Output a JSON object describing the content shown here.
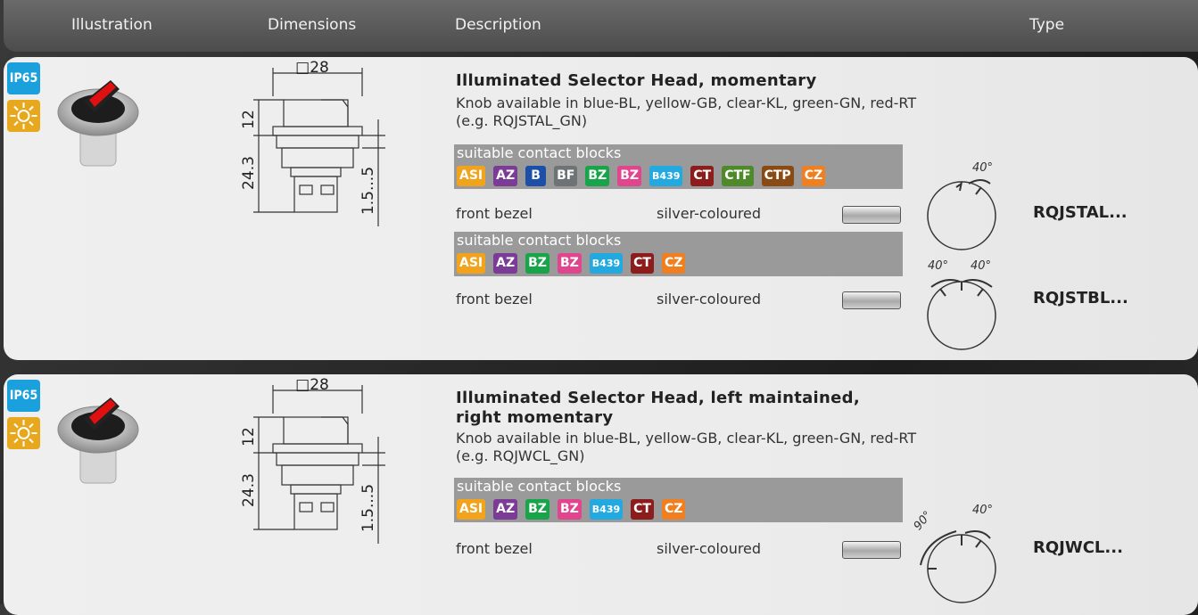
{
  "header": {
    "illustration": "Illustration",
    "dimensions": "Dimensions",
    "description": "Description",
    "type": "Type"
  },
  "dims": {
    "square": "□28",
    "height_top": "12",
    "height_body": "24.3",
    "panel_range": "1.5...5"
  },
  "products": [
    {
      "ip": "IP65",
      "title": "Illuminated Selector Head, momentary",
      "desc1": "Knob available in blue-BL, yellow-GB, clear-KL, green-GN, red-RT",
      "desc2": "(e.g. RQJSTAL_GN)",
      "variants": [
        {
          "cb_label": "suitable contact blocks",
          "badges": [
            "ASI",
            "AZ",
            "B",
            "BF",
            "BZ",
            "BZ",
            "B439",
            "CT",
            "CTF",
            "CTP",
            "CZ"
          ],
          "bezel_label": "front bezel",
          "bezel_value": "silver-coloured",
          "angles": [
            "40°"
          ],
          "type": "RQJSTAL..."
        },
        {
          "cb_label": "suitable contact blocks",
          "badges": [
            "ASI",
            "AZ",
            "BZ",
            "BZ",
            "B439",
            "CT",
            "CZ"
          ],
          "bezel_label": "front bezel",
          "bezel_value": "silver-coloured",
          "angles": [
            "40°",
            "40°"
          ],
          "type": "RQJSTBL..."
        }
      ]
    },
    {
      "ip": "IP65",
      "title": "Illuminated Selector Head, left maintained,",
      "title2": "right momentary",
      "desc1": "Knob available in blue-BL, yellow-GB, clear-KL, green-GN, red-RT",
      "desc2": "(e.g. RQJWCL_GN)",
      "variants": [
        {
          "cb_label": "suitable contact blocks",
          "badges": [
            "ASI",
            "AZ",
            "BZ",
            "BZ",
            "B439",
            "CT",
            "CZ"
          ],
          "bezel_label": "front bezel",
          "bezel_value": "silver-coloured",
          "angles": [
            "90°",
            "40°"
          ],
          "type": "RQJWCL..."
        }
      ]
    }
  ],
  "colors": {
    "ASI": "#f2a31c",
    "AZ": "#7b3b96",
    "B": "#1b4fa8",
    "BF": "#6e7375",
    "BZ1": "#18a549",
    "BZ2": "#e0458d",
    "B439": "#22a9e0",
    "CT": "#8d1c1c",
    "CTF": "#4e8a2a",
    "CTP": "#8a4a14",
    "CZ": "#f07f1f"
  }
}
